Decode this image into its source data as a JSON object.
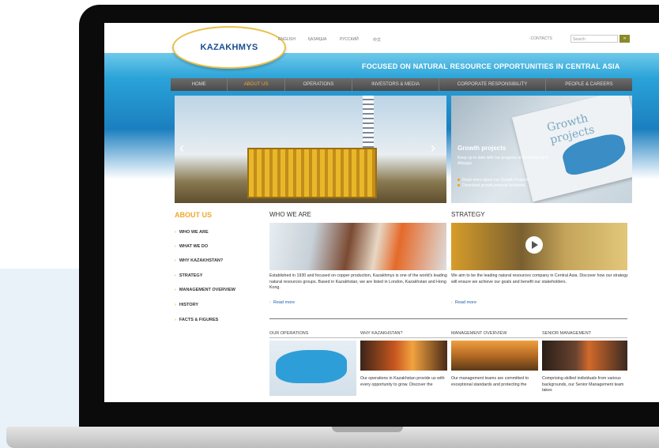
{
  "site": {
    "logo_text": "KAZAKHMYS",
    "languages": [
      "ENGLISH",
      "ҚАЗАҚША",
      "РУССКИЙ",
      "中文"
    ],
    "contacts_label": "CONTACTS",
    "search_placeholder": "Search",
    "search_button": "»",
    "tagline": "FOCUSED ON NATURAL RESOURCE OPPORTUNITIES IN CENTRAL ASIA"
  },
  "nav": [
    "HOME",
    "ABOUT US",
    "OPERATIONS",
    "INVESTORS & MEDIA",
    "CORPORATE RESPONSIBILITY",
    "PEOPLE & CAREERS"
  ],
  "hero": {
    "prev": "‹",
    "next": "›"
  },
  "growth": {
    "card_title": "Growth projects",
    "title": "Growth projects",
    "text": "Keep up to date with our progress at Bozshakol and Aktogay",
    "links": [
      "Read more about our Growth Projects",
      "Download growth projects factsheet"
    ]
  },
  "sidebar": {
    "heading": "ABOUT US",
    "items": [
      "WHO WE ARE",
      "WHAT WE DO",
      "WHY KAZAKHSTAN?",
      "STRATEGY",
      "MANAGEMENT OVERVIEW",
      "HISTORY",
      "FACTS & FIGURES"
    ]
  },
  "who": {
    "heading": "WHO WE ARE",
    "text": "Established in 1930 and focused on copper production, Kazakhmys is one of the world's leading natural resources groups. Based in Kazakhstan, we are listed in London, Kazakhstan and Hong Kong.",
    "readmore": "Read more"
  },
  "strategy": {
    "heading": "STRATEGY",
    "text": "We aim to be the leading natural resources company in Central Asia. Discover how our strategy will ensure we achieve our goals and benefit our stakeholders.",
    "readmore": "Read more"
  },
  "bottom": {
    "operations": {
      "heading": "OUR OPERATIONS"
    },
    "why": {
      "heading": "WHY KAZAKHSTAN?",
      "text": "Our operations in Kazakhstan provide us with every opportunity to grow. Discover the"
    },
    "management": {
      "heading": "MANAGEMENT OVERVIEW",
      "text": "Our management teams are committed to exceptional standards and protecting the"
    },
    "senior": {
      "heading": "SENIOR MANAGEMENT",
      "text": "Comprising skilled individuals from various backgrounds, our Senior Management team takes"
    }
  }
}
